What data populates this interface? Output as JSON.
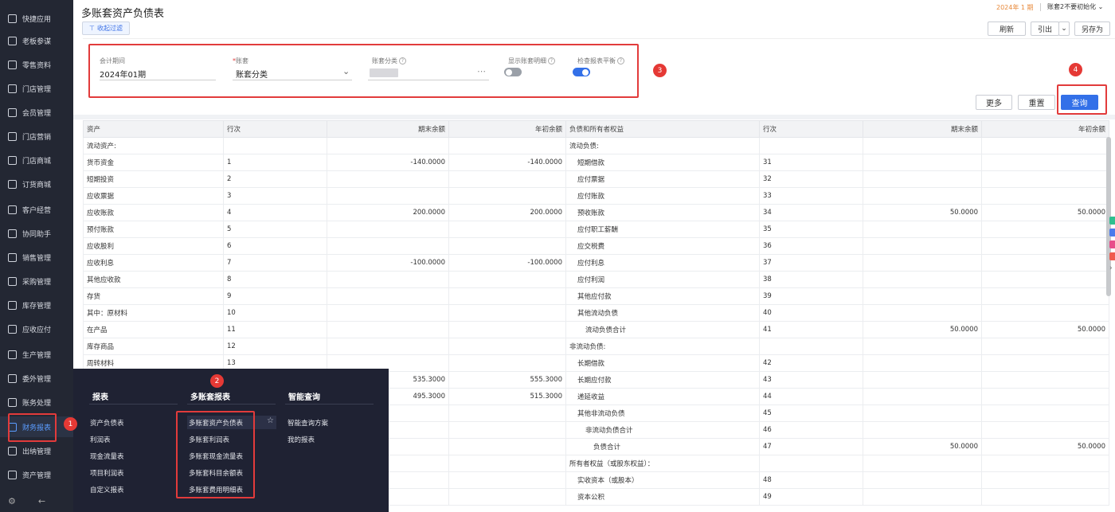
{
  "sidebar": {
    "items": [
      {
        "label": "快捷应用",
        "icon": "grid-apps-icon"
      },
      {
        "label": "老板参谋",
        "icon": "cube-icon"
      },
      {
        "label": "零售资料",
        "icon": "cart-icon"
      },
      {
        "label": "门店管理",
        "icon": "store-icon"
      },
      {
        "label": "会员管理",
        "icon": "diamond-icon"
      },
      {
        "label": "门店营销",
        "icon": "megaphone-icon"
      },
      {
        "label": "门店商城",
        "icon": "shop-icon"
      },
      {
        "label": "订货商城",
        "icon": "order-icon"
      },
      {
        "label": "客户经营",
        "icon": "customer-icon"
      },
      {
        "label": "协同助手",
        "icon": "assistant-icon"
      },
      {
        "label": "销售管理",
        "icon": "sales-chart-icon"
      },
      {
        "label": "采购管理",
        "icon": "purchase-cart-icon"
      },
      {
        "label": "库存管理",
        "icon": "warehouse-icon"
      },
      {
        "label": "应收应付",
        "icon": "receivable-icon"
      },
      {
        "label": "生产管理",
        "icon": "factory-icon"
      },
      {
        "label": "委外管理",
        "icon": "outsource-icon"
      },
      {
        "label": "账务处理",
        "icon": "ledger-icon"
      },
      {
        "label": "财务报表",
        "icon": "report-icon"
      },
      {
        "label": "出纳管理",
        "icon": "cashier-icon"
      },
      {
        "label": "资产管理",
        "icon": "asset-icon"
      }
    ],
    "active_index": 17
  },
  "header": {
    "title": "多账套资产负债表",
    "period_tag": "2024年 1 期",
    "ledger_select": "账套2不要初始化"
  },
  "toolbar": {
    "filter_toggle": "收起过滤",
    "refresh": "刷新",
    "export": "引出",
    "save_as": "另存为"
  },
  "filters": {
    "period_label": "会计期间",
    "period_value": "2024年01期",
    "ledger_label": "账套",
    "ledger_required_mark": "*",
    "ledger_value": "账套分类",
    "category_label": "账套分类",
    "show_detail_label": "显示账套明细",
    "show_detail_on": false,
    "check_balance_label": "检查报表平衡",
    "check_balance_on": true,
    "more": "更多",
    "reset": "重置",
    "query": "查询"
  },
  "annotations": {
    "b1": "1",
    "b2": "2",
    "b3": "3",
    "b4": "4"
  },
  "table": {
    "headers": [
      "资产",
      "行次",
      "期末余额",
      "年初余额",
      "负债和所有者权益",
      "行次",
      "期末余额",
      "年初余额"
    ],
    "rows": [
      [
        "流动资产:",
        "",
        "",
        "",
        "流动负债:",
        "",
        "",
        ""
      ],
      [
        "货币资金",
        "1",
        "-140.0000",
        "-140.0000",
        "短期借款",
        "31",
        "",
        ""
      ],
      [
        "短期投资",
        "2",
        "",
        "",
        "应付票据",
        "32",
        "",
        ""
      ],
      [
        "应收票据",
        "3",
        "",
        "",
        "应付账款",
        "33",
        "",
        ""
      ],
      [
        "应收账款",
        "4",
        "200.0000",
        "200.0000",
        "预收账款",
        "34",
        "50.0000",
        "50.0000"
      ],
      [
        "预付账款",
        "5",
        "",
        "",
        "应付职工薪酬",
        "35",
        "",
        ""
      ],
      [
        "应收股利",
        "6",
        "",
        "",
        "应交税费",
        "36",
        "",
        ""
      ],
      [
        "应收利息",
        "7",
        "-100.0000",
        "-100.0000",
        "应付利息",
        "37",
        "",
        ""
      ],
      [
        "其他应收款",
        "8",
        "",
        "",
        "应付利润",
        "38",
        "",
        ""
      ],
      [
        "存货",
        "9",
        "",
        "",
        "其他应付款",
        "39",
        "",
        ""
      ],
      [
        "其中：原材料",
        "10",
        "",
        "",
        "其他流动负债",
        "40",
        "",
        ""
      ],
      [
        "在产品",
        "11",
        "",
        "",
        "流动负债合计",
        "41",
        "50.0000",
        "50.0000"
      ],
      [
        "库存商品",
        "12",
        "",
        "",
        "非流动负债:",
        "",
        "",
        ""
      ],
      [
        "周转材料",
        "13",
        "",
        "",
        "长期借款",
        "42",
        "",
        ""
      ],
      [
        "",
        "",
        "535.3000",
        "555.3000",
        "长期应付款",
        "43",
        "",
        ""
      ],
      [
        "",
        "",
        "495.3000",
        "515.3000",
        "递延收益",
        "44",
        "",
        ""
      ],
      [
        "",
        "",
        "",
        "",
        "其他非流动负债",
        "45",
        "",
        ""
      ],
      [
        "",
        "",
        "",
        "",
        "非流动负债合计",
        "46",
        "",
        ""
      ],
      [
        "",
        "",
        "",
        "",
        "负债合计",
        "47",
        "50.0000",
        "50.0000"
      ],
      [
        "",
        "",
        "",
        "",
        "所有者权益（或股东权益）：",
        "",
        "",
        ""
      ],
      [
        "",
        "",
        "",
        "",
        "实收资本（或股本）",
        "48",
        "",
        ""
      ],
      [
        "",
        "",
        "",
        "",
        "资本公积",
        "49",
        "",
        ""
      ]
    ],
    "indents": [
      0,
      1,
      1,
      1,
      1,
      1,
      1,
      1,
      1,
      1,
      1,
      2,
      0,
      1,
      1,
      1,
      1,
      2,
      3,
      0,
      1,
      1
    ]
  },
  "menu": {
    "col1": {
      "title": "报表",
      "items": [
        "资产负债表",
        "利润表",
        "现金流量表",
        "项目利润表",
        "自定义报表"
      ]
    },
    "col2": {
      "title": "多账套报表",
      "items": [
        "多账套资产负债表",
        "多账套利润表",
        "多账套现金流量表",
        "多账套科目余额表",
        "多账套费用明细表"
      ]
    },
    "col3": {
      "title": "智能查询",
      "items": [
        "智能查询方案",
        "我的报表"
      ]
    }
  },
  "colors": {
    "accent": "#3370e8",
    "sidebar_bg": "#232733",
    "menu_bg": "#1f2233",
    "highlight_red": "#e23b3b"
  }
}
